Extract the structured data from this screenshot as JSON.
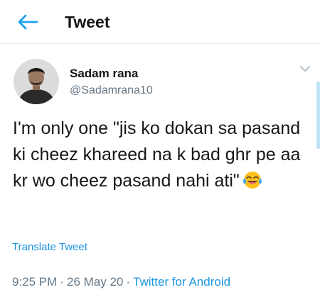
{
  "header": {
    "title": "Tweet",
    "back_icon": "arrow-left-icon",
    "accent_color": "#1da1f2"
  },
  "author": {
    "name": "Sadam rana",
    "handle": "@Sadamrana10"
  },
  "tweet": {
    "text": "I'm only one \"jis ko dokan sa pasand ki cheez khareed na k bad ghr pe aa kr wo cheez pasand nahi ati\"",
    "emoji": "face-with-tears-of-joy-icon",
    "translate_label": "Translate Tweet",
    "time": "9:25 PM",
    "separator": "·",
    "date": "26 May 20",
    "source": "Twitter for Android"
  },
  "colors": {
    "text": "#14171a",
    "secondary": "#657786",
    "link": "#1b95e0"
  }
}
